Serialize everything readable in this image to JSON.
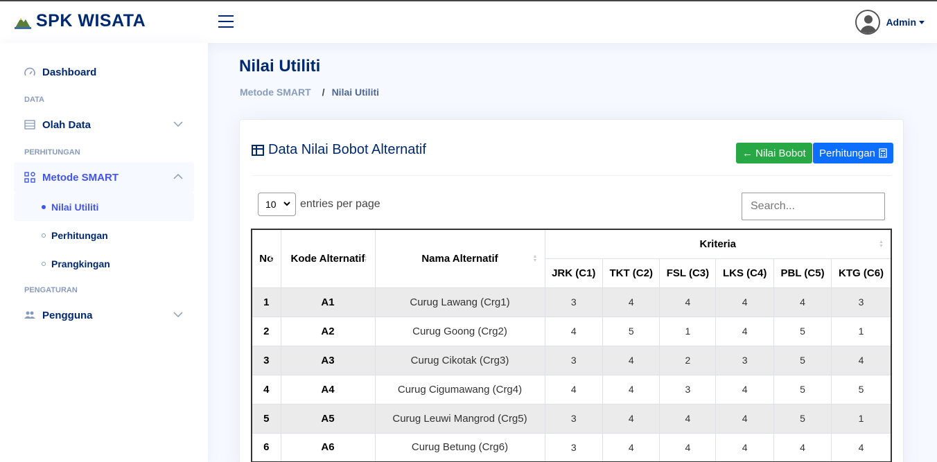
{
  "header": {
    "brand": "SPK WISATA",
    "user_name": "Admin"
  },
  "sidebar": {
    "dashboard": "Dashboard",
    "heading_data": "DATA",
    "olah_data": "Olah Data",
    "heading_perhitungan": "PERHITUNGAN",
    "metode_smart": "Metode SMART",
    "sub_items": [
      "Nilai Utiliti",
      "Perhitungan",
      "Prangkingan"
    ],
    "heading_pengaturan": "PENGATURAN",
    "pengguna": "Pengguna"
  },
  "main": {
    "page_title": "Nilai Utiliti",
    "breadcrumb": [
      "Metode SMART",
      "Nilai Utiliti"
    ],
    "card_title": "Data Nilai Bobot Alternatif",
    "btn_back": "← Nilai Bobot",
    "btn_next": "Perhitungan",
    "entries_value": "10",
    "entries_label": "entries per page",
    "search_placeholder": "Search..."
  },
  "table": {
    "headers": {
      "no": "No",
      "kode": "Kode Alternatif",
      "nama": "Nama Alternatif",
      "kriteria": "Kriteria",
      "criteria": [
        "JRK (C1)",
        "TKT (C2)",
        "FSL (C3)",
        "LKS (C4)",
        "PBL (C5)",
        "KTG (C6)"
      ]
    },
    "rows": [
      {
        "no": "1",
        "kode": "A1",
        "nama": "Curug Lawang (Crg1)",
        "v": [
          "3",
          "4",
          "4",
          "4",
          "4",
          "3"
        ]
      },
      {
        "no": "2",
        "kode": "A2",
        "nama": "Curug Goong (Crg2)",
        "v": [
          "4",
          "5",
          "1",
          "4",
          "5",
          "1"
        ]
      },
      {
        "no": "3",
        "kode": "A3",
        "nama": "Curug Cikotak (Crg3)",
        "v": [
          "3",
          "4",
          "2",
          "3",
          "5",
          "4"
        ]
      },
      {
        "no": "4",
        "kode": "A4",
        "nama": "Curug Cigumawang (Crg4)",
        "v": [
          "4",
          "4",
          "3",
          "4",
          "5",
          "5"
        ]
      },
      {
        "no": "5",
        "kode": "A5",
        "nama": "Curug Leuwi Mangrod (Crg5)",
        "v": [
          "3",
          "4",
          "4",
          "4",
          "5",
          "1"
        ]
      },
      {
        "no": "6",
        "kode": "A6",
        "nama": "Curug Betung (Crg6)",
        "v": [
          "3",
          "4",
          "4",
          "4",
          "4",
          "4"
        ]
      }
    ]
  }
}
